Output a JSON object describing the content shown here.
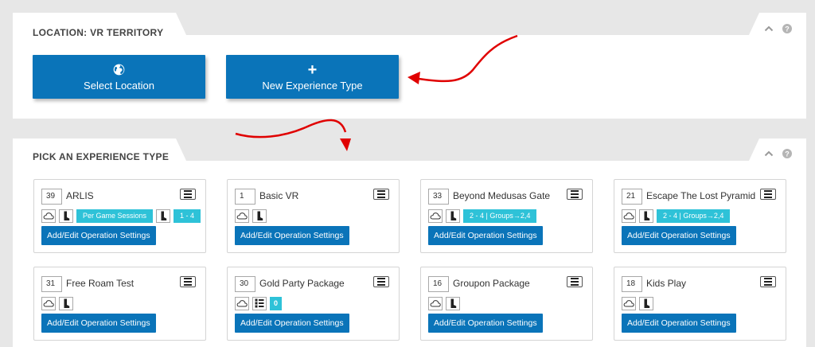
{
  "location_panel": {
    "title": "LOCATION: VR TERRITORY",
    "select_location_label": "Select Location",
    "new_experience_type_label": "New Experience Type"
  },
  "experience_panel": {
    "title": "PICK AN EXPERIENCE TYPE",
    "cards": [
      {
        "count": "39",
        "name": "ARLIS",
        "tags": [
          "Per Game Sessions",
          "1 - 4"
        ],
        "button": "Add/Edit Operation Settings"
      },
      {
        "count": "1",
        "name": "Basic VR",
        "tags": [],
        "button": "Add/Edit Operation Settings"
      },
      {
        "count": "33",
        "name": "Beyond Medusas Gate",
        "tags": [
          "2 - 4 | Groups→2,4"
        ],
        "button": "Add/Edit Operation Settings"
      },
      {
        "count": "21",
        "name": "Escape The Lost Pyramid",
        "tags": [
          "2 - 4 | Groups→2,4"
        ],
        "button": "Add/Edit Operation Settings"
      },
      {
        "count": "31",
        "name": "Free Roam Test",
        "tags": [],
        "button": "Add/Edit Operation Settings"
      },
      {
        "count": "30",
        "name": "Gold Party Package",
        "tags": [
          "0"
        ],
        "button": "Add/Edit Operation Settings"
      },
      {
        "count": "16",
        "name": "Groupon Package",
        "tags": [],
        "button": "Add/Edit Operation Settings"
      },
      {
        "count": "18",
        "name": "Kids Play",
        "tags": [],
        "button": "Add/Edit Operation Settings"
      }
    ]
  },
  "colors": {
    "primary_button": "#0a74b9",
    "tag": "#2ec2d8",
    "annotation_arrow": "#e00000",
    "page_background": "#e7e7e7"
  },
  "icons": [
    "globe-icon",
    "plus-icon",
    "chevron-up-icon",
    "help-icon",
    "cloud-icon",
    "boot-icon",
    "list-icon",
    "hamburger-icon"
  ]
}
